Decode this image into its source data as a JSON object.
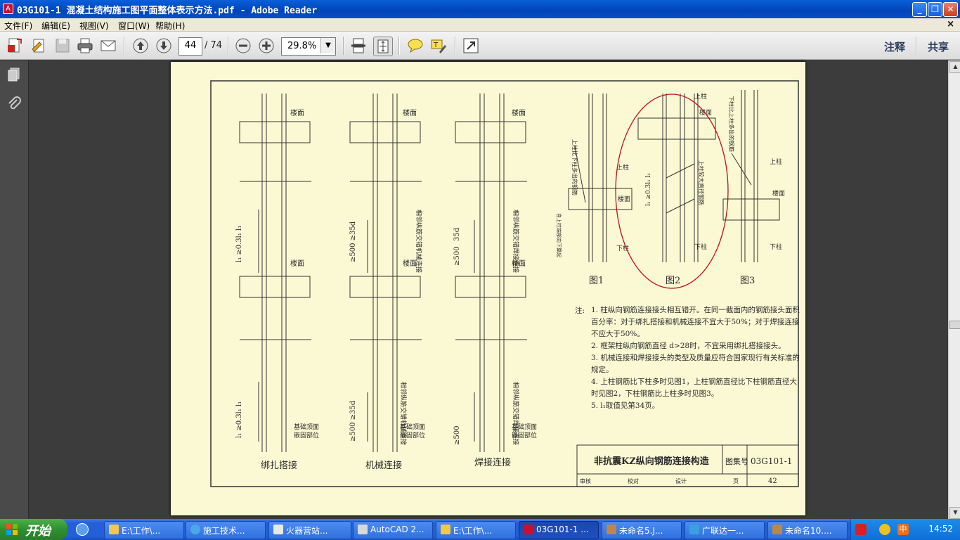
{
  "window": {
    "title": "03G101-1 混凝土结构施工图平面整体表示方法.pdf - Adobe Reader",
    "app_icon": "pdf-icon"
  },
  "menu": [
    {
      "label": "文件(F)"
    },
    {
      "label": "编辑(E)"
    },
    {
      "label": "视图(V)"
    },
    {
      "label": "窗口(W)"
    },
    {
      "label": "帮助(H)"
    }
  ],
  "menu_close": "×",
  "toolbar": {
    "page_current": "44",
    "page_total": "/ 74",
    "zoom": "29.8%",
    "comment_label": "注释",
    "share_label": "共享"
  },
  "drawing": {
    "col1_label": "绑扎搭接",
    "col2_label": "机械连接",
    "col3_label": "焊接连接",
    "floor_label": "楼面",
    "base_label_1": "基础顶面",
    "base_label_2": "嵌固部位",
    "dim_lap": "l₁ ≥0.3l₁ l₁",
    "dim_500_35d": "≥500 ≥35d",
    "dim_500": "≥500",
    "dim_35d": "35d",
    "mech_note": "相邻纵筋交错机械连接",
    "weld_note": "相邻纵筋交错焊接连接",
    "fig1": "图1",
    "fig2": "图2",
    "fig3": "图3",
    "upper_col": "上柱",
    "lower_col": "下柱",
    "fig1_note": "上柱比下柱多出的钢筋",
    "fig2_note": "上柱较大直径钢筋",
    "fig3_note": "下柱比上柱多出的钢筋",
    "fig1_note2": "自上柱端部向下算起",
    "notes_prefix": "注:",
    "notes": [
      "1. 柱纵向钢筋连接接头相互错开。在同一截面内的钢筋接头面积百分率：对于绑扎搭接和机械连接不宜大于50%；对于焊接连接不应大于50%。",
      "2. 框架柱纵向钢筋直径 d>28时，不宜采用绑扎搭接接头。",
      "3. 机械连接和焊接接头的类型及质量应符合国家现行有关标准的规定。",
      "4. 上柱钢筋比下柱多时见图1，上柱钢筋直径比下柱钢筋直径大时见图2，下柱钢筋比上柱多时见图3。",
      "5. l₁取值见第34页。"
    ],
    "titleblock_title": "非抗震KZ纵向钢筋连接构造",
    "titleblock_setlabel": "图集号",
    "titleblock_setno": "03G101-1",
    "sig_review": "审核",
    "sig_check": "校对",
    "sig_design": "设计",
    "page_label": "页",
    "page_no": "42"
  },
  "taskbar": {
    "start_label": "开始",
    "tasks": [
      {
        "label": "E:\\工作\\...",
        "icon": "folder-icon"
      },
      {
        "label": "施工技术...",
        "icon": "browser-icon"
      },
      {
        "label": "火器营站...",
        "icon": "doc-icon"
      },
      {
        "label": "AutoCAD 2...",
        "icon": "autocad-icon"
      },
      {
        "label": "E:\\工作\\...",
        "icon": "folder-icon"
      },
      {
        "label": "03G101-1 ...",
        "icon": "pdf-icon"
      },
      {
        "label": "未命名5.J...",
        "icon": "image-icon"
      },
      {
        "label": "广联达一...",
        "icon": "app-icon"
      },
      {
        "label": "未命名10....",
        "icon": "image-icon"
      }
    ],
    "clock": "14:52",
    "ime": "中"
  },
  "colors": {
    "page_bg": "#fbf9d3",
    "annotation_ellipse": "#c0101a",
    "taskbar": "#245edb",
    "titlebar": "#0a5fd8"
  }
}
